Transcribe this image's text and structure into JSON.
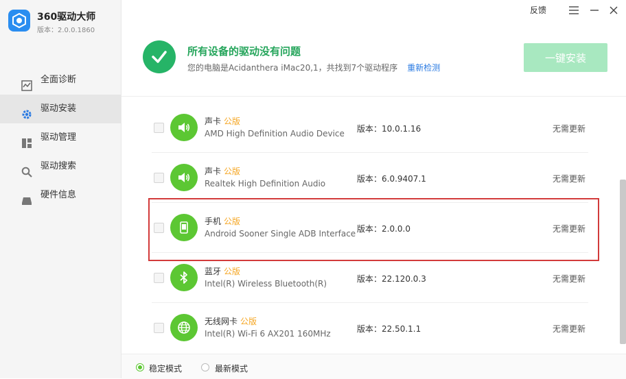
{
  "app": {
    "title": "360驱动大师",
    "version": "版本：2.0.0.1860",
    "brand_color": "#2a8df0"
  },
  "window": {
    "feedback_label": "反馈"
  },
  "sidebar": {
    "items": [
      {
        "label": "全面诊断",
        "icon": "diagnosis-icon",
        "active": false
      },
      {
        "label": "驱动安装",
        "icon": "gear-icon",
        "active": true
      },
      {
        "label": "驱动管理",
        "icon": "grid-icon",
        "active": false
      },
      {
        "label": "驱动搜索",
        "icon": "search-icon",
        "active": false
      },
      {
        "label": "硬件信息",
        "icon": "hardware-icon",
        "active": false
      }
    ]
  },
  "header": {
    "status_title": "所有设备的驱动没有问题",
    "status_sub": "您的电脑是Acidanthera iMac20,1，共找到7个驱动程序",
    "rescan_label": "重新检测",
    "install_label": "一键安装",
    "accent_color": "#26b467"
  },
  "devices": [
    {
      "type": "声卡",
      "badge": "公版",
      "name": "AMD High Definition Audio Device",
      "version": "版本：10.0.1.16",
      "status": "无需更新",
      "icon": "speaker-icon"
    },
    {
      "type": "声卡",
      "badge": "公版",
      "name": "Realtek High Definition Audio",
      "version": "版本：6.0.9407.1",
      "status": "无需更新",
      "icon": "speaker-icon"
    },
    {
      "type": "手机",
      "badge": "公版",
      "name": "Android Sooner Single ADB Interface",
      "version": "版本：2.0.0.0",
      "status": "无需更新",
      "icon": "phone-icon"
    },
    {
      "type": "蓝牙",
      "badge": "公版",
      "name": "Intel(R) Wireless Bluetooth(R)",
      "version": "版本：22.120.0.3",
      "status": "无需更新",
      "icon": "bluetooth-icon"
    },
    {
      "type": "无线网卡",
      "badge": "公版",
      "name": "Intel(R) Wi-Fi 6 AX201 160MHz",
      "version": "版本：22.50.1.1",
      "status": "无需更新",
      "icon": "globe-icon"
    }
  ],
  "footer": {
    "mode_stable": "稳定模式",
    "mode_latest": "最新模式",
    "selected": "稳定模式"
  }
}
